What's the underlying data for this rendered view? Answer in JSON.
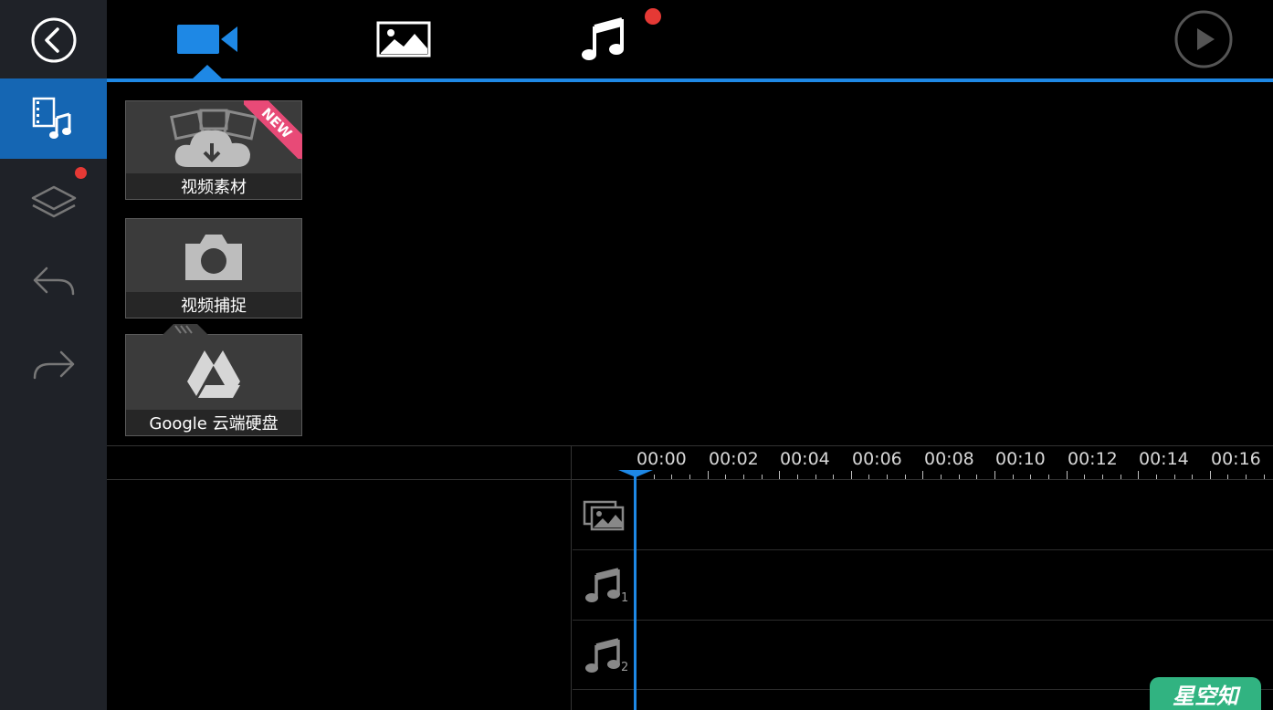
{
  "tabs": [
    {
      "name": "video",
      "icon": "video-camera-icon",
      "active": true
    },
    {
      "name": "photo",
      "icon": "image-icon",
      "active": false
    },
    {
      "name": "music",
      "icon": "music-note-icon",
      "active": false,
      "badge": true
    }
  ],
  "sidebar": {
    "items": [
      {
        "icon": "media-library-icon",
        "active": true
      },
      {
        "icon": "layers-icon",
        "badge": true
      },
      {
        "icon": "undo-icon"
      },
      {
        "icon": "redo-icon"
      }
    ]
  },
  "tiles": [
    {
      "label": "视频素材",
      "icon": "cloud-download-icon",
      "ribbon": "NEW"
    },
    {
      "label": "视频捕捉",
      "icon": "camera-icon"
    },
    {
      "label": "Google 云端硬盘",
      "icon": "google-drive-icon"
    }
  ],
  "timeline": {
    "ruler": [
      "00:00",
      "00:02",
      "00:04",
      "00:06",
      "00:08",
      "00:10",
      "00:12",
      "00:14",
      "00:16"
    ],
    "tracks": [
      {
        "icon": "video-image-track-icon",
        "num": ""
      },
      {
        "icon": "music-track-icon",
        "num": "1"
      },
      {
        "icon": "music-track-icon",
        "num": "2"
      }
    ]
  },
  "watermark": "星空知",
  "colors": {
    "accent": "#1e88e5",
    "sidebar": "#1f2228",
    "active": "#1566b3",
    "badge": "#e53935",
    "ribbon": "#e84a77"
  }
}
